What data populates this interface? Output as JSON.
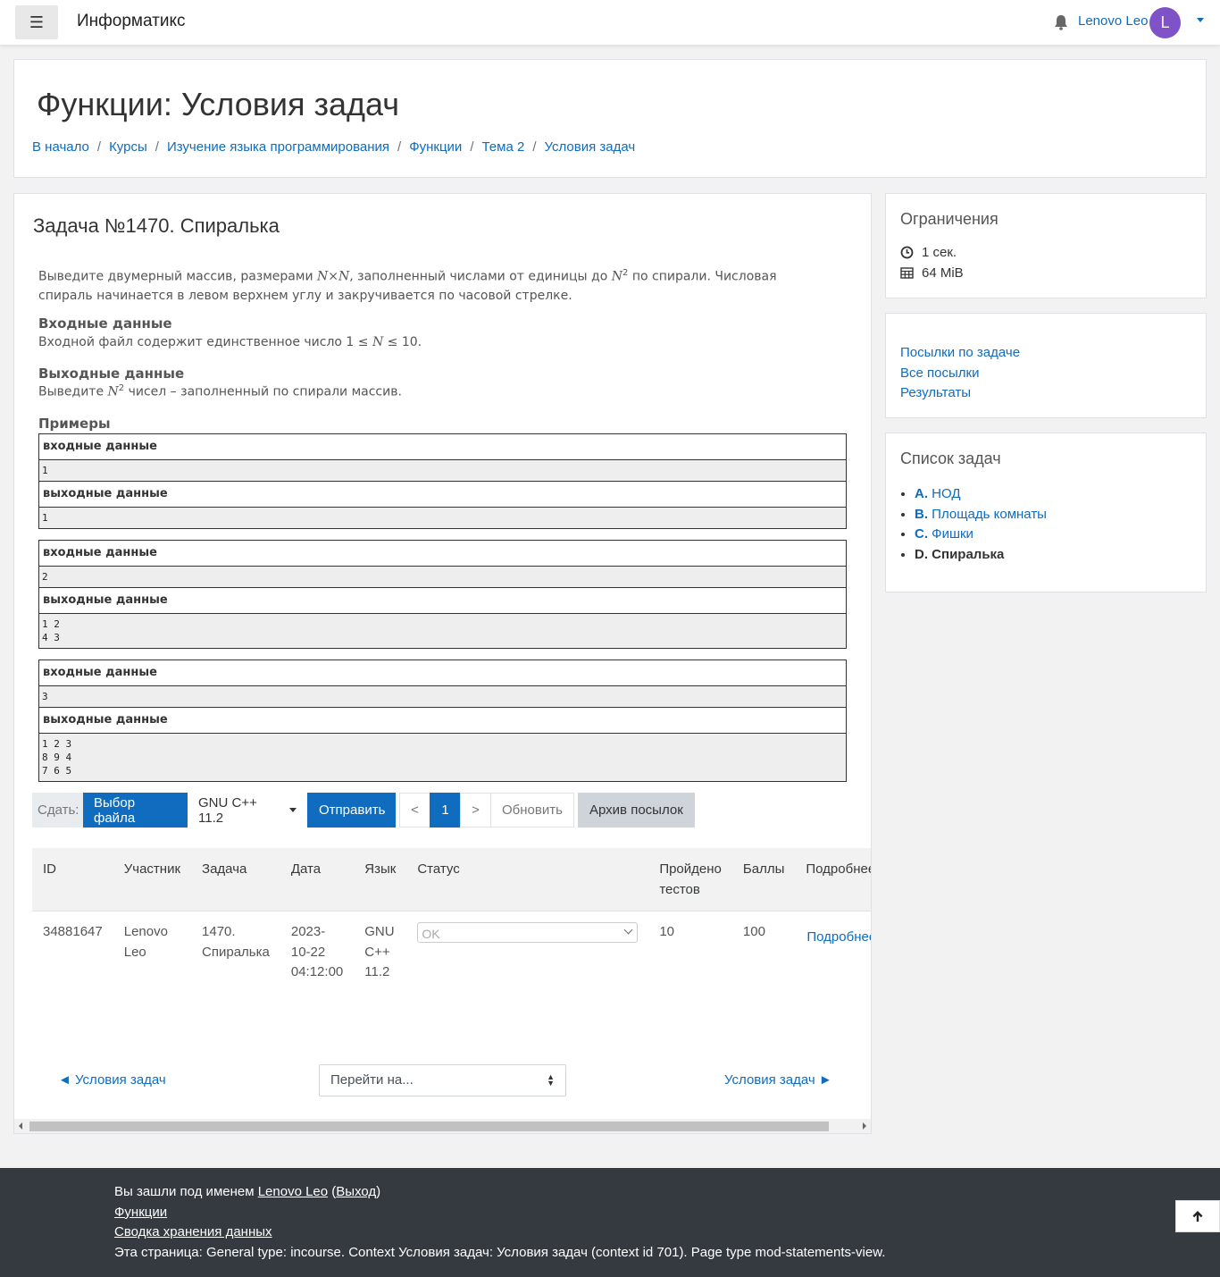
{
  "navbar": {
    "brand": "Информатикс",
    "user_name": "Lenovo Leo",
    "avatar_letter": "L",
    "icons": [
      "bars-icon",
      "bell-icon",
      "chevron-down-icon"
    ]
  },
  "header": {
    "title": "Функции: Условия задач",
    "breadcrumb": [
      "В начало",
      "Курсы",
      "Изучение языка программирования",
      "Функции",
      "Тема 2",
      "Условия задач"
    ],
    "separator": "/"
  },
  "problem": {
    "title": "Задача №1470. Спиралька",
    "statement_parts": {
      "p1": "Выведите двумерный массив, размерами ",
      "nxn": "N×N",
      "p2": ", заполненный числами от единицы до ",
      "n": "N",
      "sup": "2",
      "p3": " по спирали. Числовая спираль начинается в левом верхнем углу и закручивается по часовой стрелке."
    },
    "input_heading": "Входные данные",
    "input_text": {
      "a": "Входной файл содержит единственное число 1 ≤ ",
      "n": "N",
      "b": " ≤ 10."
    },
    "output_heading": "Выходные данные",
    "output_text": {
      "a": "Выведите ",
      "n": "N",
      "sup": "2",
      "b": " чисел – заполненный по спирали массив."
    },
    "examples_heading": "Примеры",
    "input_label": "входные данные",
    "output_label": "выходные данные",
    "examples": [
      {
        "input": "1",
        "output": "1"
      },
      {
        "input": "2",
        "output": "1 2\n4 3"
      },
      {
        "input": "3",
        "output": "1 2 3\n8 9 4\n7 6 5"
      }
    ]
  },
  "toolbar": {
    "submit_label": "Сдать:",
    "choose_file": "Выбор файла",
    "language": "GNU C++ 11.2",
    "send": "Отправить",
    "prev": "<",
    "page": "1",
    "next": ">",
    "refresh": "Обновить",
    "archive": "Архив посылок"
  },
  "submissions": {
    "headers": {
      "id": "ID",
      "user": "Участник",
      "task": "Задача",
      "date": "Дата",
      "lang": "Язык",
      "status": "Статус",
      "tests_1": "Пройдено",
      "tests_2": "тестов",
      "score": "Баллы",
      "details": "Подробнее"
    },
    "rows": [
      {
        "id": "34881647",
        "user_1": "Lenovo",
        "user_2": "Leo",
        "task_1": "1470.",
        "task_2": "Спиралька",
        "date_1": "2023-",
        "date_2": "10-22",
        "date_3": "04:12:00",
        "lang_1": "GNU",
        "lang_2": "C++",
        "lang_3": "11.2",
        "status": "OK",
        "tests": "10",
        "score": "100",
        "details": "Подробнее"
      }
    ]
  },
  "activity_nav": {
    "prev": "◄ Условия задач",
    "jump_placeholder": "Перейти на...",
    "next": "Условия задач ►"
  },
  "limits": {
    "title": "Ограничения",
    "time": "1 сек.",
    "memory": "64 MiB"
  },
  "links_block": {
    "items": [
      "Посылки по задаче",
      "Все посылки",
      "Результаты"
    ]
  },
  "task_list": {
    "title": "Список задач",
    "items": [
      {
        "letter": "A.",
        "name": "НОД"
      },
      {
        "letter": "B.",
        "name": "Площадь комнаты"
      },
      {
        "letter": "C.",
        "name": "Фишки"
      },
      {
        "letter": "D.",
        "name": "Спиралька"
      }
    ]
  },
  "footer": {
    "logged_prefix": "Вы зашли под именем ",
    "user": "Lenovo Leo",
    "open_paren": " (",
    "logout": "Выход",
    "close_paren": ")",
    "course_link": "Функции",
    "data_link": "Сводка хранения данных",
    "page_info": "Эта страница: General type: incourse. Context Условия задач: Условия задач (context id 701). Page type mod-statements-view."
  }
}
